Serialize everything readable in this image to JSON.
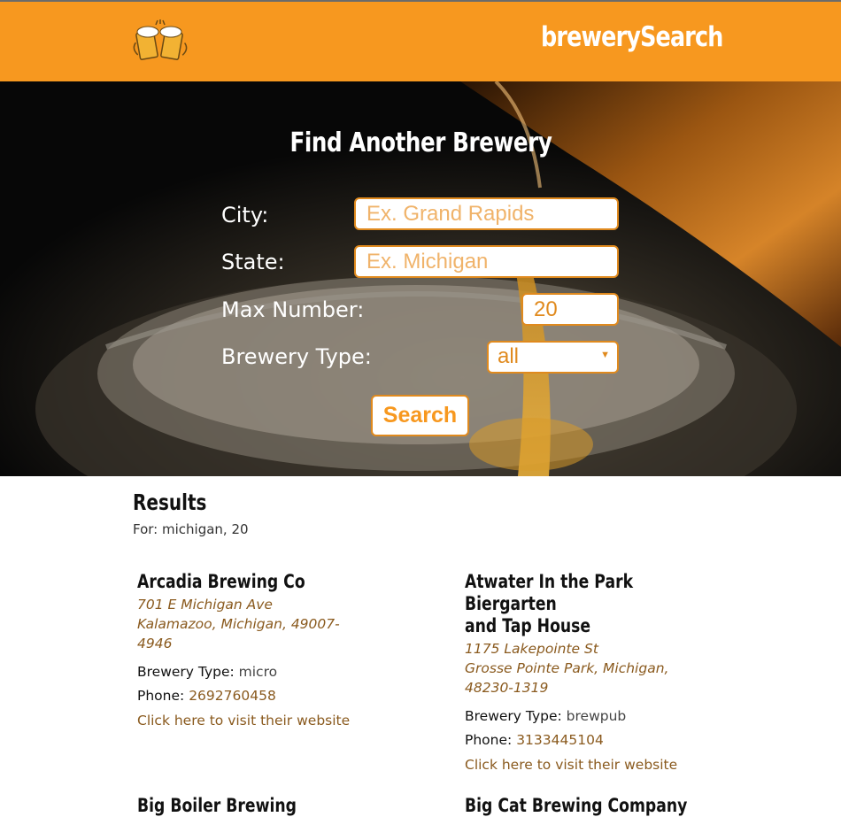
{
  "header": {
    "brand": "brewerySearch",
    "logo_icon": "beer-mugs-icon"
  },
  "hero": {
    "title": "Find Another Brewery",
    "city": {
      "label": "City:",
      "placeholder": "Ex. Grand Rapids",
      "value": ""
    },
    "state": {
      "label": "State:",
      "placeholder": "Ex. Michigan",
      "value": ""
    },
    "max_number": {
      "label": "Max Number:",
      "value": "20"
    },
    "brewery_type": {
      "label": "Brewery Type:",
      "selected": "all"
    },
    "search_label": "Search"
  },
  "results": {
    "title": "Results",
    "for_text": "For: michigan, 20",
    "items": [
      {
        "name": "Arcadia Brewing Co",
        "street": "701 E Michigan Ave",
        "city_line": "Kalamazoo, Michigan, 49007-4946",
        "type_label": "Brewery Type:",
        "type": "micro",
        "phone_label": "Phone:",
        "phone": "2692760458",
        "website_text": "Click here to visit their website"
      },
      {
        "name_line1": "Atwater In the Park Biergarten",
        "name_line2": "and Tap House",
        "street": "1175 Lakepointe St",
        "city_line1": "Grosse Pointe Park, Michigan,",
        "city_line2": "48230-1319",
        "type_label": "Brewery Type:",
        "type": "brewpub",
        "phone_label": "Phone:",
        "phone": "3133445104",
        "website_text": "Click here to visit their website"
      },
      {
        "name": "Big Boiler Brewing"
      },
      {
        "name": "Big Cat Brewing Company"
      }
    ]
  },
  "colors": {
    "accent": "#f7981f",
    "link": "#8a5a1e",
    "field_border": "#e08a1e"
  }
}
